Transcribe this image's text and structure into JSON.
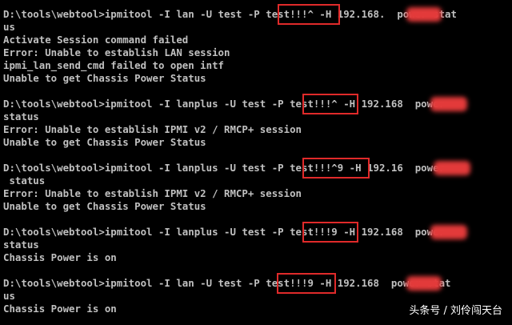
{
  "console": {
    "lines": [
      "D:\\tools\\webtool>ipmitool -I lan -U test -P test!!!^ -H 192.168.  power stat",
      "us",
      "Activate Session command failed",
      "Error: Unable to establish LAN session",
      "ipmi_lan_send_cmd failed to open intf",
      "Unable to get Chassis Power Status",
      "",
      "D:\\tools\\webtool>ipmitool -I lanplus -U test -P test!!!^ -H 192.168  power",
      "status",
      "Error: Unable to establish IPMI v2 / RMCP+ session",
      "Unable to get Chassis Power Status",
      "",
      "D:\\tools\\webtool>ipmitool -I lanplus -U test -P test!!!^9 -H 192.16  power",
      " status",
      "Error: Unable to establish IPMI v2 / RMCP+ session",
      "Unable to get Chassis Power Status",
      "",
      "D:\\tools\\webtool>ipmitool -I lanplus -U test -P test!!!9 -H 192.168  power",
      "status",
      "Chassis Power is on",
      "",
      "D:\\tools\\webtool>ipmitool -I lan -U test -P test!!!9 -H 192.168  power stat",
      "us",
      "Chassis Power is on"
    ]
  },
  "watermark": "头条号 / 刘伶闯天台",
  "colors": {
    "background": "#000000",
    "text": "#c0c0c0",
    "highlight": "#e02a2a",
    "redaction": "#e33a3a"
  }
}
